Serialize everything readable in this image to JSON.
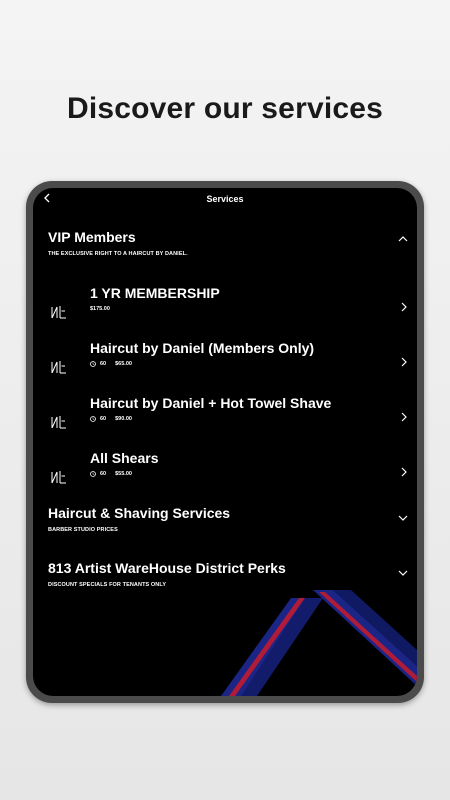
{
  "headline": "Discover our services",
  "topbar": {
    "title": "Services",
    "back_icon": "chevron-left-icon"
  },
  "vip": {
    "title": "VIP Members",
    "subtitle": "THE EXCLUSIVE RIGHT TO A HAIRCUT BY DANIEL.",
    "expanded": true,
    "items": [
      {
        "title": "1 YR MEMBERSHIP",
        "duration": "",
        "price": "$175.00"
      },
      {
        "title": "Haircut by Daniel (Members Only)",
        "duration": "60",
        "price": "$65.00"
      },
      {
        "title": "Haircut by Daniel + Hot Towel Shave",
        "duration": "60",
        "price": "$90.00"
      },
      {
        "title": "All Shears",
        "duration": "60",
        "price": "$55.00"
      }
    ]
  },
  "haircut": {
    "title": "Haircut & Shaving Services",
    "subtitle": "BARBER STUDIO PRICES",
    "expanded": false
  },
  "perks": {
    "title": "813 Artist WareHouse District Perks",
    "subtitle": "DISCOUNT SPECIALS FOR TENANTS ONLY",
    "expanded": false
  },
  "colors": {
    "background": "#000000",
    "text": "#ffffff",
    "device_frame": "#4b4b4b",
    "accent_red": "#c0203a",
    "accent_blue": "#1c2a8c"
  }
}
